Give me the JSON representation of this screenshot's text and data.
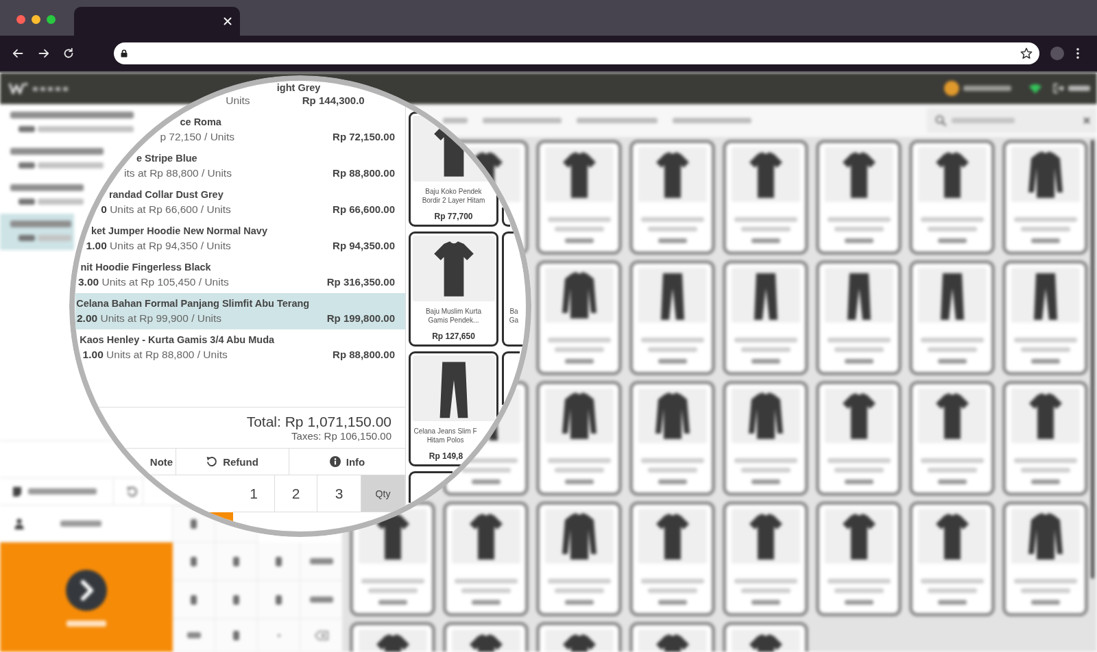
{
  "browser": {
    "tabs": [
      {
        "selected": true
      }
    ],
    "address_bar": {
      "secure": true,
      "starred": false
    }
  },
  "pos": {
    "order_lines": [
      {
        "selected": false
      },
      {
        "selected": false
      },
      {
        "selected": false
      },
      {
        "selected": true
      }
    ],
    "products": [
      {
        "kind": "shirt"
      },
      {
        "kind": "shirt"
      },
      {
        "kind": "shirt"
      },
      {
        "kind": "shirt"
      },
      {
        "kind": "shirt"
      },
      {
        "kind": "shirt"
      },
      {
        "kind": "jacket"
      },
      {
        "kind": "jacket"
      },
      {
        "kind": "pants"
      },
      {
        "kind": "pants"
      },
      {
        "kind": "pants"
      },
      {
        "kind": "pants"
      },
      {
        "kind": "pants"
      },
      {
        "kind": "pants"
      },
      {
        "kind": "jacket"
      },
      {
        "kind": "jacket"
      },
      {
        "kind": "jacket"
      },
      {
        "kind": "shirt"
      },
      {
        "kind": "shirt"
      },
      {
        "kind": "shirt"
      },
      {
        "kind": "shirt"
      },
      {
        "kind": "shirt"
      },
      {
        "kind": "jacket"
      },
      {
        "kind": "shirt"
      },
      {
        "kind": "shirt"
      },
      {
        "kind": "shirt"
      },
      {
        "kind": "shirt"
      },
      {
        "kind": "jacket"
      },
      {
        "kind": "shirt"
      },
      {
        "kind": "shirt"
      },
      {
        "kind": "shirt"
      },
      {
        "kind": "shirt"
      },
      {
        "kind": "shirt"
      }
    ]
  },
  "magnifier": {
    "order_lines": [
      {
        "name": "ight Grey",
        "detail": "Units",
        "price": "Rp 144,300.0",
        "selected": false
      },
      {
        "name": "ce Roma",
        "detail": "p 72,150 / Units",
        "price": "Rp 72,150.00",
        "selected": false
      },
      {
        "name": "e Stripe Blue",
        "detail": "its at Rp 88,800 / Units",
        "price": "Rp 88,800.00",
        "selected": false
      },
      {
        "name": "randad Collar Dust Grey",
        "detail": "**0** Units at Rp 66,600 / Units",
        "price": "Rp 66,600.00",
        "selected": false
      },
      {
        "name": "ket Jumper Hoodie New Normal Navy",
        "detail": "**1.00** Units at Rp 94,350 / Units",
        "price": "Rp 94,350.00",
        "selected": false
      },
      {
        "name": "nit Hoodie Fingerless Black",
        "detail": "**3.00** Units at Rp 105,450 / Units",
        "price": "Rp 316,350.00",
        "selected": false
      },
      {
        "name": "Celana Bahan Formal Panjang Slimfit Abu Terang",
        "detail": "**2.00** Units at Rp 99,900 / Units",
        "price": "Rp 199,800.00",
        "selected": true
      },
      {
        "name": "Kaos Henley - Kurta Gamis 3/4 Abu Muda",
        "detail": "**1.00** Units at Rp 88,800 / Units",
        "price": "Rp 88,800.00",
        "selected": false
      }
    ],
    "total": "Total: Rp 1,071,150.00",
    "taxes": "Taxes: Rp 106,150.00",
    "actions": [
      {
        "label": "Note",
        "kind": "plain"
      },
      {
        "label": "Refund",
        "kind": "undo"
      },
      {
        "label": "Info",
        "kind": "info"
      }
    ],
    "numpad": [
      {
        "label": "1",
        "kind": "digit",
        "selected": false
      },
      {
        "label": "2",
        "kind": "digit",
        "selected": false
      },
      {
        "label": "3",
        "kind": "digit",
        "selected": false
      },
      {
        "label": "Qty",
        "kind": "mode",
        "selected": true
      }
    ],
    "products": [
      {
        "kind": "shirt",
        "name_lines": [
          "Baju Koko Pendek",
          "Bordir 2 Layer Hitam"
        ],
        "price": "Rp 77,700"
      },
      {
        "kind": "frame"
      },
      {
        "kind": "shirt",
        "name_lines": [
          "Baju Muslim Kurta",
          "Gamis Pendek..."
        ],
        "price": "Rp 127,650"
      },
      {
        "kind": "frame",
        "name_lines": [
          "Ba",
          "Ga"
        ]
      },
      {
        "kind": "pants",
        "name_lines": [
          "Celana Jeans Slim F",
          "Hitam Polos"
        ],
        "price": "Rp 149,8"
      },
      {
        "kind": "frame"
      },
      {
        "kind": "frame"
      }
    ]
  }
}
